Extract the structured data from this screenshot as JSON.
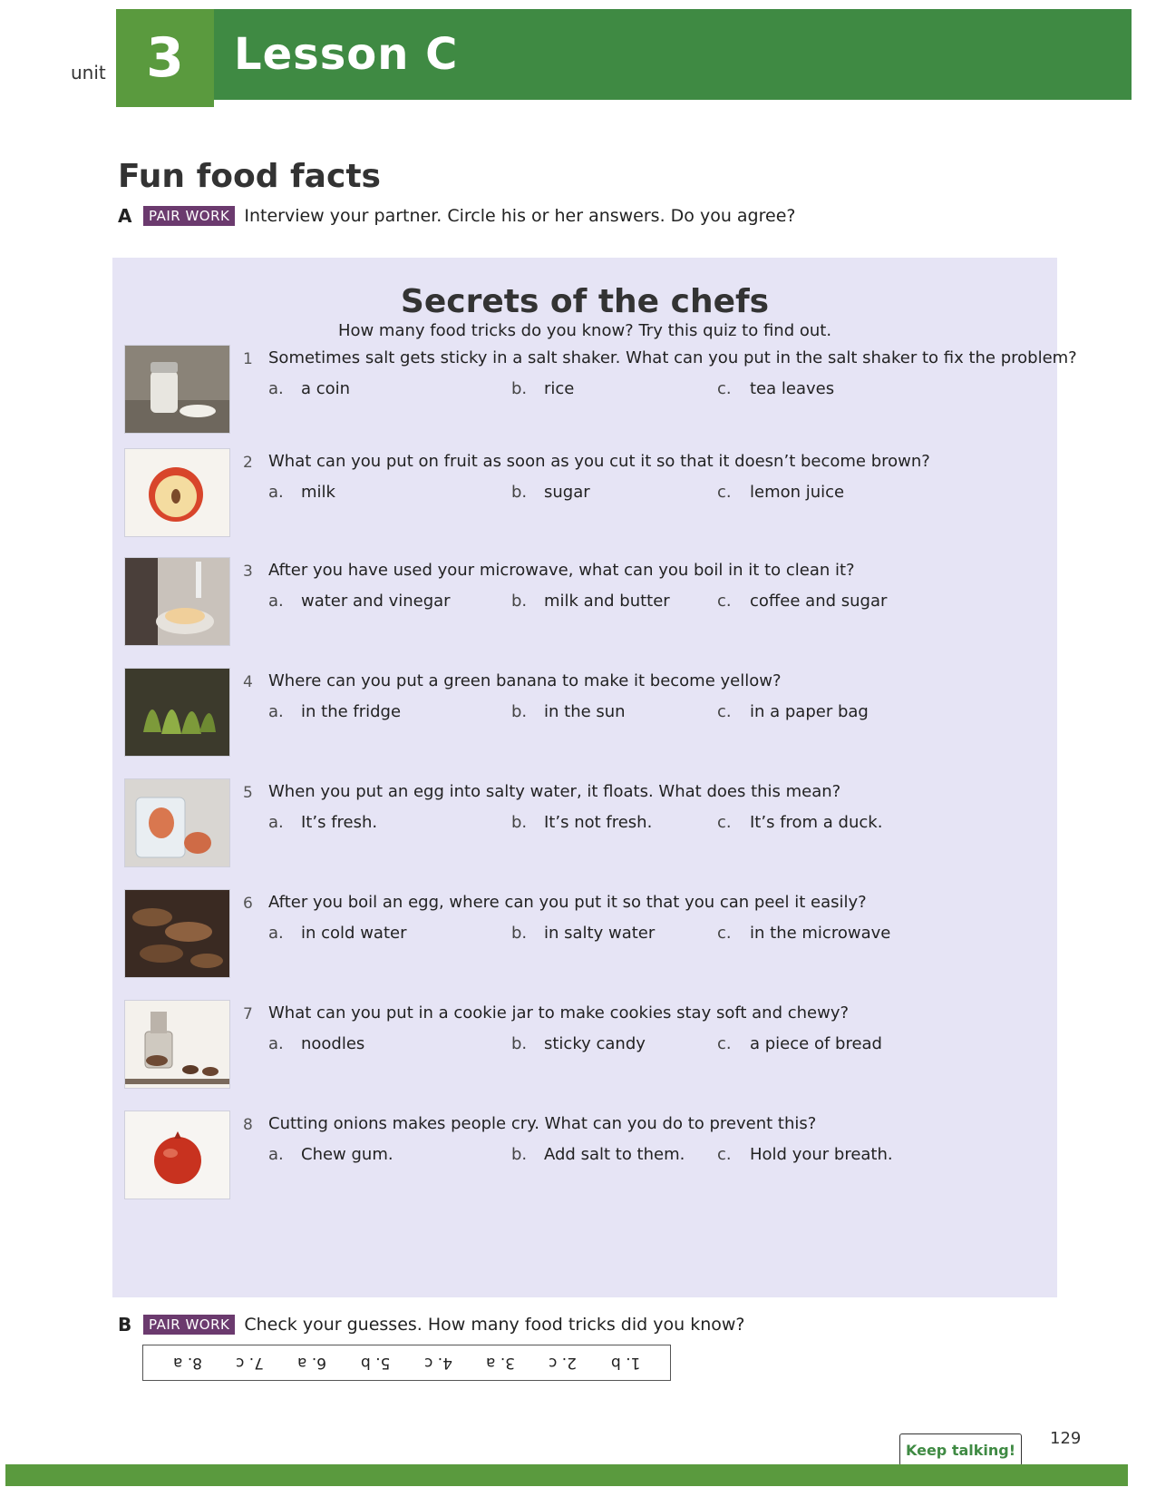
{
  "header": {
    "unit_label": "unit",
    "unit_number": "3",
    "lesson_title": "Lesson C",
    "colors": {
      "unit_box": "#5a9a3e",
      "title_bar": "#3f8a43"
    }
  },
  "section_title": "Fun food facts",
  "exercise_a": {
    "letter": "A",
    "badge": "PAIR WORK",
    "instruction": "Interview your partner. Circle his or her answers. Do you agree?"
  },
  "quiz": {
    "title": "Secrets of the chefs",
    "subtitle": "How many food tricks do you know? Try this quiz to find out.",
    "panel_color": "#e6e4f5",
    "questions": [
      {
        "num": "1",
        "text": "Sometimes salt gets sticky in a salt shaker. What can you put in the salt shaker to fix the problem?",
        "options": [
          {
            "letter": "a.",
            "text": "a coin"
          },
          {
            "letter": "b.",
            "text": "rice"
          },
          {
            "letter": "c.",
            "text": "tea leaves"
          }
        ],
        "photo_icon": "salt-shaker-photo"
      },
      {
        "num": "2",
        "text": "What can you put on fruit as soon as you cut it so that it doesn’t become brown?",
        "options": [
          {
            "letter": "a.",
            "text": "milk"
          },
          {
            "letter": "b.",
            "text": "sugar"
          },
          {
            "letter": "c.",
            "text": "lemon juice"
          }
        ],
        "photo_icon": "cut-apple-photo"
      },
      {
        "num": "3",
        "text": "After you have used your microwave, what can you boil in it to clean it?",
        "options": [
          {
            "letter": "a.",
            "text": "water and vinegar"
          },
          {
            "letter": "b.",
            "text": "milk and butter"
          },
          {
            "letter": "c.",
            "text": "coffee and sugar"
          }
        ],
        "photo_icon": "microwave-bowl-photo"
      },
      {
        "num": "4",
        "text": "Where can you put a green banana to make it become yellow?",
        "options": [
          {
            "letter": "a.",
            "text": "in the fridge"
          },
          {
            "letter": "b.",
            "text": "in the sun"
          },
          {
            "letter": "c.",
            "text": "in a paper bag"
          }
        ],
        "photo_icon": "green-bananas-photo"
      },
      {
        "num": "5",
        "text": "When you put an egg into salty water, it floats. What does this mean?",
        "options": [
          {
            "letter": "a.",
            "text": "It’s fresh."
          },
          {
            "letter": "b.",
            "text": "It’s not fresh."
          },
          {
            "letter": "c.",
            "text": "It’s from a duck."
          }
        ],
        "photo_icon": "egg-in-water-photo"
      },
      {
        "num": "6",
        "text": "After you boil an egg, where can you put it so that you can peel it easily?",
        "options": [
          {
            "letter": "a.",
            "text": "in cold water"
          },
          {
            "letter": "b.",
            "text": "in salty water"
          },
          {
            "letter": "c.",
            "text": "in the microwave"
          }
        ],
        "photo_icon": "cookies-photo"
      },
      {
        "num": "7",
        "text": "What can you put in a cookie jar to make cookies stay soft and chewy?",
        "options": [
          {
            "letter": "a.",
            "text": "noodles"
          },
          {
            "letter": "b.",
            "text": "sticky candy"
          },
          {
            "letter": "c.",
            "text": "a piece of bread"
          }
        ],
        "photo_icon": "cookie-jar-photo"
      },
      {
        "num": "8",
        "text": "Cutting onions makes people cry. What can you do to prevent this?",
        "options": [
          {
            "letter": "a.",
            "text": "Chew gum."
          },
          {
            "letter": "b.",
            "text": "Add salt to them."
          },
          {
            "letter": "c.",
            "text": "Hold your breath."
          }
        ],
        "photo_icon": "onion-photo"
      }
    ]
  },
  "exercise_b": {
    "letter": "B",
    "badge": "PAIR WORK",
    "instruction": "Check your guesses. How many food tricks did you know?",
    "answers_upside_down": [
      "8. a",
      "7. c",
      "6. a",
      "5. b",
      "4. c",
      "3. a",
      "2. c",
      "1. b"
    ]
  },
  "footer": {
    "keep_talking": "Keep talking!",
    "page_number": "129",
    "bar_color": "#5a9a3e"
  }
}
